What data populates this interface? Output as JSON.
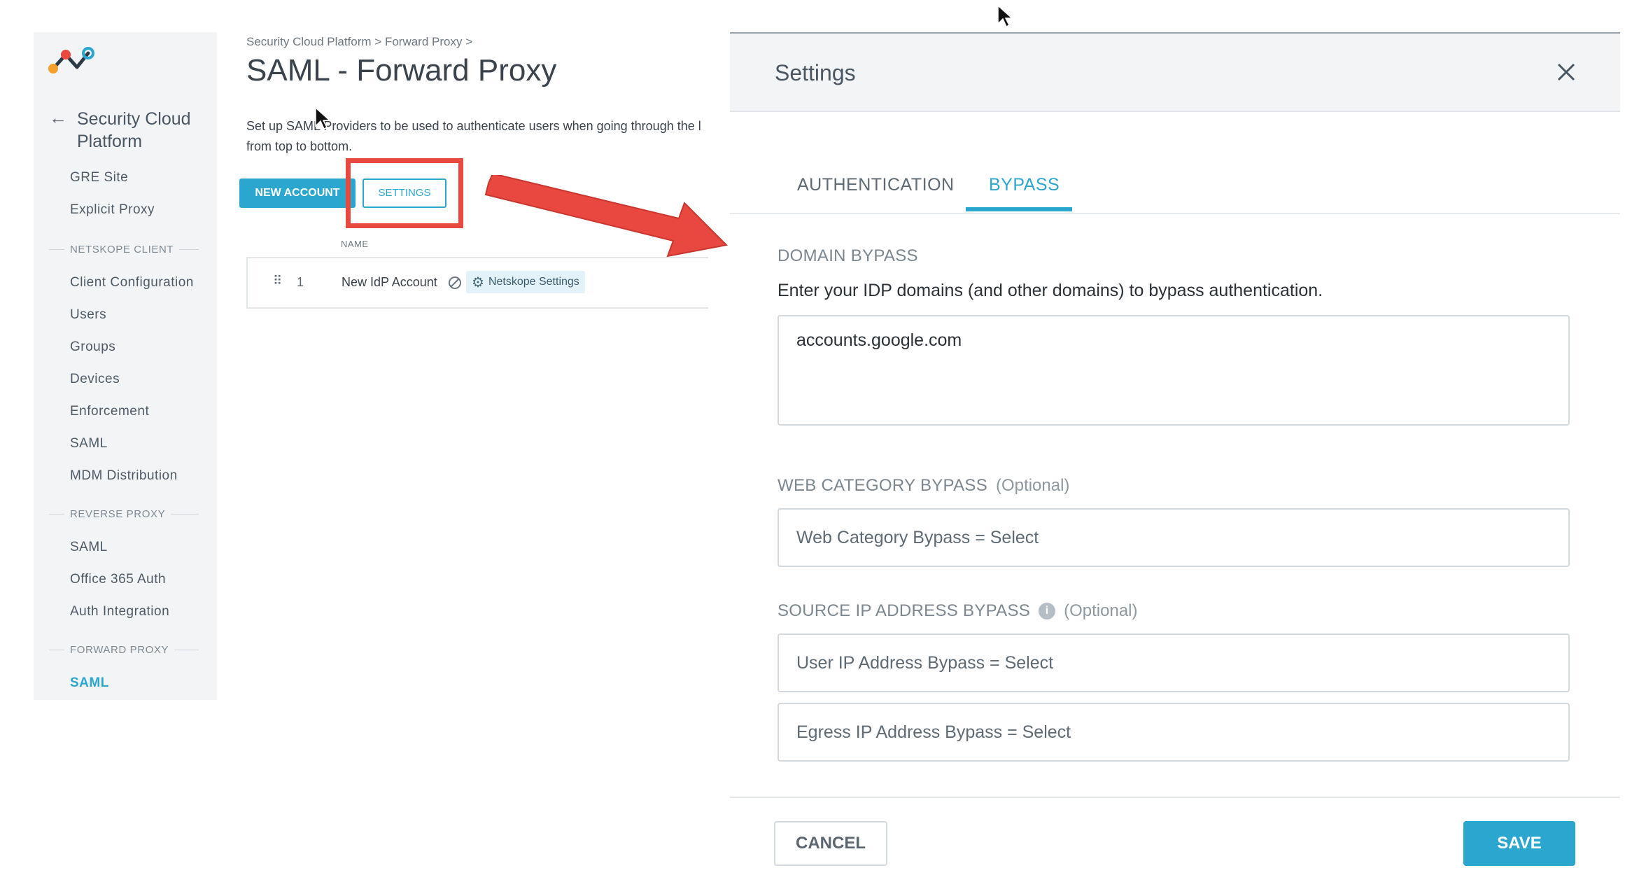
{
  "colors": {
    "accent": "#2ba7cf",
    "highlight": "#e8483f",
    "sidebar_bg": "#f2f4f6"
  },
  "sidebar": {
    "back_label": "Security Cloud Platform",
    "items_top": [
      {
        "label": "GRE Site"
      },
      {
        "label": "Explicit Proxy"
      }
    ],
    "sections": [
      {
        "title": "NETSKOPE CLIENT",
        "items": [
          {
            "label": "Client Configuration"
          },
          {
            "label": "Users"
          },
          {
            "label": "Groups"
          },
          {
            "label": "Devices"
          },
          {
            "label": "Enforcement"
          },
          {
            "label": "SAML"
          },
          {
            "label": "MDM Distribution"
          }
        ]
      },
      {
        "title": "REVERSE PROXY",
        "items": [
          {
            "label": "SAML"
          },
          {
            "label": "Office 365 Auth"
          },
          {
            "label": "Auth Integration"
          }
        ]
      },
      {
        "title": "FORWARD PROXY",
        "items": [
          {
            "label": "SAML",
            "active": true
          }
        ]
      }
    ]
  },
  "main": {
    "breadcrumb": "Security Cloud Platform > Forward Proxy >",
    "title": "SAML - Forward Proxy",
    "description_line1": "Set up SAML Providers to be used to authenticate users when going through the l",
    "description_line2": "from top to bottom.",
    "new_account_label": "NEW ACCOUNT",
    "settings_label": "SETTINGS",
    "table": {
      "column_name": "NAME",
      "rows": [
        {
          "index": "1",
          "name": "New IdP Account",
          "chip_label": "Netskope Settings",
          "drag_icon": "drag-handle-icon",
          "status_icon": "disabled-icon"
        }
      ]
    }
  },
  "modal": {
    "title": "Settings",
    "close_icon": "close-icon",
    "tabs": [
      {
        "label": "AUTHENTICATION",
        "active": false
      },
      {
        "label": "BYPASS",
        "active": true
      }
    ],
    "domain_bypass": {
      "heading": "DOMAIN BYPASS",
      "description": "Enter your IDP domains (and other domains) to bypass authentication.",
      "value": "accounts.google.com"
    },
    "web_category_bypass": {
      "heading": "WEB CATEGORY BYPASS",
      "optional": "(Optional)",
      "select_text": "Web Category Bypass = Select"
    },
    "source_ip_bypass": {
      "heading": "SOURCE IP ADDRESS BYPASS",
      "optional": "(Optional)",
      "info_icon": "info-icon",
      "user_select_text": "User IP Address Bypass = Select",
      "egress_select_text": "Egress IP Address Bypass = Select"
    },
    "cancel_label": "CANCEL",
    "save_label": "SAVE"
  }
}
